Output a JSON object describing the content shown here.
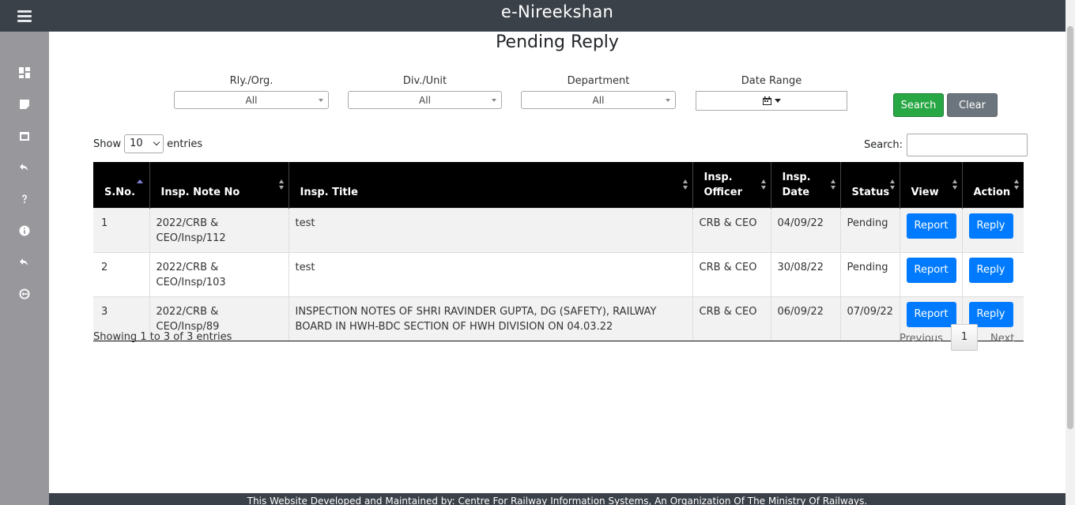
{
  "header": {
    "title": "e-Nireekshan"
  },
  "page": {
    "title": "Pending Reply"
  },
  "sidebar": {
    "icons": [
      "dashboard-icon",
      "note-icon",
      "calendar-icon",
      "reply-icon",
      "help-icon",
      "info-icon",
      "reply-icon",
      "logout-icon"
    ]
  },
  "filters": {
    "rly": {
      "label": "Rly./Org.",
      "value": "All"
    },
    "div": {
      "label": "Div./Unit",
      "value": "All"
    },
    "dept": {
      "label": "Department",
      "value": "All"
    },
    "date": {
      "label": "Date Range"
    },
    "search_button": "Search",
    "clear_button": "Clear"
  },
  "table_controls": {
    "show_label": "Show",
    "entries_label": "entries",
    "page_length": "10",
    "search_label": "Search:"
  },
  "table": {
    "columns": [
      {
        "l1": "",
        "l2": "S.No."
      },
      {
        "l1": "",
        "l2": "Insp. Note No"
      },
      {
        "l1": "",
        "l2": "Insp. Title"
      },
      {
        "l1": "Insp.",
        "l2": "Officer"
      },
      {
        "l1": "Insp.",
        "l2": "Date"
      },
      {
        "l1": "",
        "l2": "Status"
      },
      {
        "l1": "",
        "l2": "View"
      },
      {
        "l1": "",
        "l2": "Action"
      }
    ],
    "rows": [
      {
        "sno": "1",
        "note_no": "2022/CRB & CEO/Insp/112",
        "title": "test",
        "officer": "CRB & CEO",
        "date": "04/09/22",
        "status": "Pending",
        "view": "Report",
        "action": "Reply"
      },
      {
        "sno": "2",
        "note_no": "2022/CRB & CEO/Insp/103",
        "title": "test",
        "officer": "CRB & CEO",
        "date": "30/08/22",
        "status": "Pending",
        "view": "Report",
        "action": "Reply"
      },
      {
        "sno": "3",
        "note_no": "2022/CRB & CEO/Insp/89",
        "title": "INSPECTION NOTES OF SHRI RAVINDER GUPTA, DG (SAFETY), RAILWAY BOARD IN HWH-BDC SECTION OF HWH DIVISION ON 04.03.22",
        "officer": "CRB & CEO",
        "date": "06/09/22",
        "status": "07/09/22",
        "view": "Report",
        "action": "Reply"
      }
    ]
  },
  "pagination": {
    "info": "Showing 1 to 3 of 3 entries",
    "previous": "Previous",
    "current": "1",
    "next": "Next"
  },
  "footer": {
    "text": "This Website Developed and Maintained by: Centre For Railway Information Systems, An Organization Of The Ministry Of Railways."
  },
  "colors": {
    "header": "#3b4149",
    "sidebar": "#97979c",
    "primary": "#007bff",
    "success": "#28a745",
    "secondary": "#6c757d"
  }
}
